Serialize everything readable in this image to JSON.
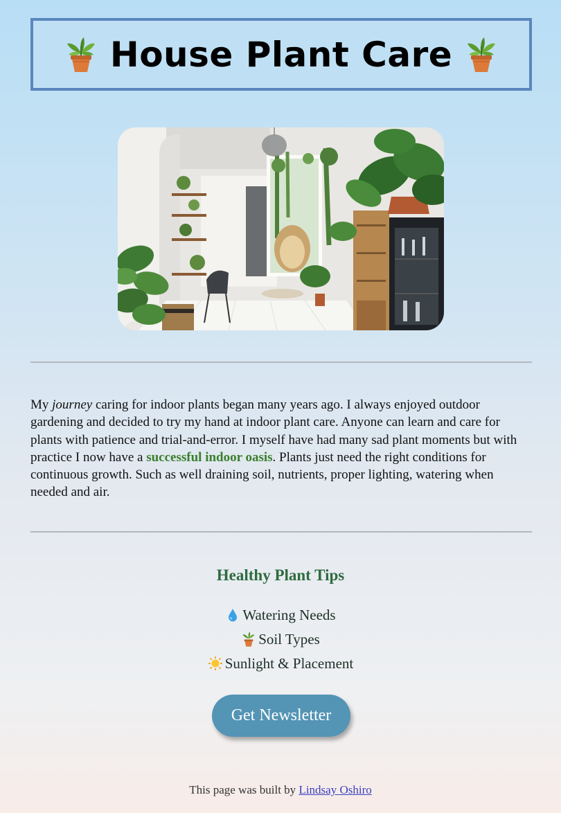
{
  "header": {
    "title": "House Plant Care",
    "left_icon": "potted-plant-icon",
    "right_icon": "potted-plant-icon"
  },
  "hero_image": {
    "subject": "bright white room filled with house plants"
  },
  "intro": {
    "part1": "My ",
    "em": "journey",
    "part2": " caring for indoor plants began many years ago. I always enjoyed outdoor gardening and decided to try my hand at indoor plant care. Anyone can learn and care for plants with patience and trial-and-error. I myself have had many sad plant moments but with practice I now have a ",
    "strong": "successful indoor oasis",
    "part3": ". Plants just need the right conditions for continuous growth. Such as well draining soil, nutrients, proper lighting, watering when needed and air."
  },
  "tips": {
    "title": "Healthy Plant Tips",
    "items": [
      {
        "icon": "droplet-icon",
        "label": "Watering Needs"
      },
      {
        "icon": "potted-plant-icon",
        "label": "Soil Types"
      },
      {
        "icon": "sun-icon",
        "label": "Sunlight & Placement"
      }
    ]
  },
  "cta": {
    "label": "Get Newsletter"
  },
  "footer": {
    "prefix": "This page was built by ",
    "author": "Lindsay Oshiro"
  },
  "colors": {
    "header_border": "#5b86bd",
    "accent_green": "#3a7f2c",
    "title_green": "#2f6b3f",
    "button": "#5494b5",
    "link": "#3b3fbd"
  }
}
